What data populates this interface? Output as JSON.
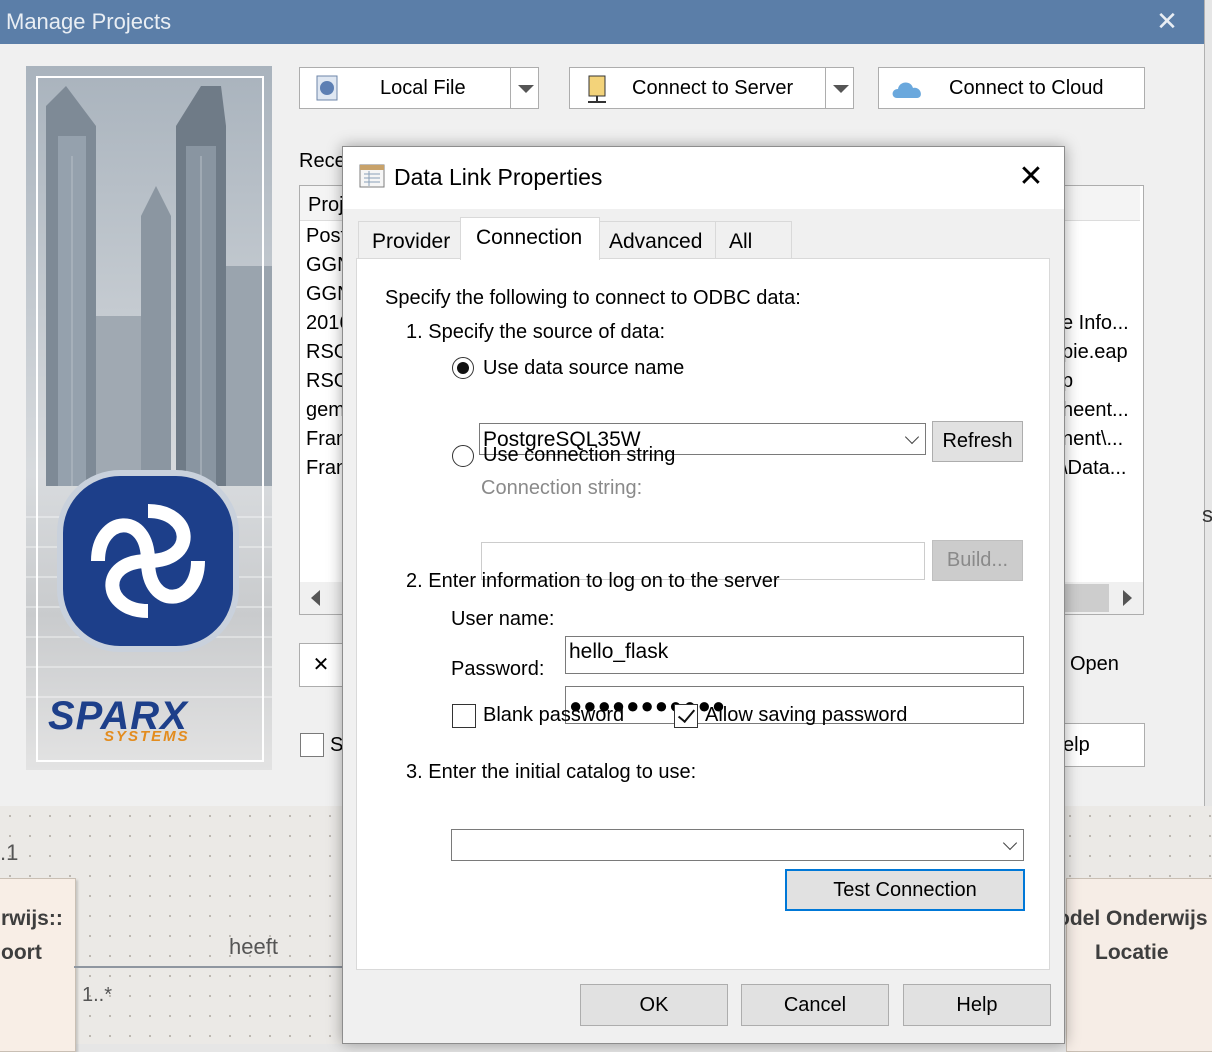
{
  "diagram": {
    "multiplicity_top": ".1",
    "left_class_line1": "rwijs::",
    "left_class_line2": "oort",
    "assoc_label": "heeft",
    "multiplicity_bottom": "1..*",
    "right_class_line1": "odel Onderwijs",
    "right_class_line2": "Locatie",
    "edge_fragment": "s"
  },
  "manage_projects": {
    "title": "Manage Projects",
    "close_glyph": "✕",
    "logo_word": "SPARX",
    "logo_sub": "SYSTEMS",
    "buttons": {
      "local_file": "Local File",
      "connect_server": "Connect to Server",
      "connect_cloud": "Connect to Cloud"
    },
    "recent_label": "Rece",
    "project_header": "Proj",
    "projects_left": [
      "Post",
      "GGN",
      "GGN",
      "2016",
      "RSG",
      "RSG",
      "gem",
      "Fran",
      "Fran"
    ],
    "projects_right": [
      "e Info...",
      "pie.eap",
      "p",
      "heent...",
      "nent\\...",
      "\\Data..."
    ],
    "delete_glyph": "✕",
    "checkbox_label": "S",
    "open_label": "Open",
    "help_label": "elp"
  },
  "dialog": {
    "title": "Data Link Properties",
    "close_glyph": "✕",
    "tabs": [
      "Provider",
      "Connection",
      "Advanced",
      "All"
    ],
    "active_tab": "Connection",
    "intro": "Specify the following to connect to ODBC data:",
    "step1": "1. Specify the source of data:",
    "use_dsn_label": "Use data source name",
    "dsn_value": "PostgreSQL35W",
    "refresh_label": "Refresh",
    "use_connstr_label": "Use connection string",
    "connstr_label": "Connection string:",
    "connstr_value": "",
    "build_label": "Build...",
    "step2": "2. Enter information to log on to the server",
    "username_label": "User name:",
    "username_value": "hello_flask",
    "password_label": "Password:",
    "password_mask": "●●●●●●●●●●●",
    "blank_password_label": "Blank password",
    "allow_saving_label": "Allow saving password",
    "step3": "3. Enter the initial catalog to use:",
    "catalog_value": "",
    "test_connection_label": "Test Connection",
    "ok_label": "OK",
    "cancel_label": "Cancel",
    "help_label": "Help"
  },
  "colors": {
    "mp_titlebar": "#5b7ea8",
    "focus_accent": "#0078d7",
    "sparx_blue": "#1d3f8a",
    "sparx_orange": "#e38c1e"
  }
}
